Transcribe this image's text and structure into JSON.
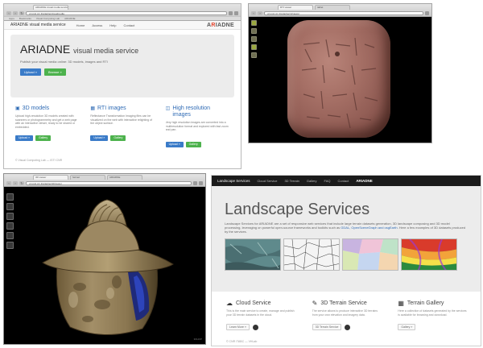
{
  "panel1": {
    "tab": "ARIADNE visual media service",
    "url": "vcg.isti.cnr.it/ariadne/visualmedia",
    "bookmarks": [
      "Apps",
      "Bookmarks",
      "Visual Computing Lab",
      "ARIADNE"
    ],
    "nav": {
      "brand": "ARIADNE visual media service",
      "items": [
        "Home",
        "Access",
        "Help",
        "Contact"
      ],
      "logo_pre": "A",
      "logo_r": "R",
      "logo_post": "IADNE"
    },
    "hero": {
      "title": "ARIADNE",
      "title_small": "visual media service",
      "lead": "Publish your visual media online: 3D models, images and RTI",
      "btn_primary": "Upload »",
      "btn_secondary": "Browse »"
    },
    "columns": [
      {
        "icon": "▣",
        "title": "3D models",
        "text": "Upload high-resolution 3D models created with scanners or photogrammetry and get a web page with an interactive viewer, ready to be shared or embedded.",
        "btn_primary": "Upload »",
        "btn_secondary": "Gallery"
      },
      {
        "icon": "▦",
        "title": "RTI images",
        "text": "Reflectance Transformation Imaging files can be visualized on the web with interactive relighting of the object surface.",
        "btn_primary": "Upload »",
        "btn_secondary": "Gallery"
      },
      {
        "icon": "◫",
        "title": "High resolution images",
        "text": "Very high resolution images are converted into a multiresolution format and explored with fast zoom and pan.",
        "btn_primary": "Upload »",
        "btn_secondary": "Gallery"
      }
    ],
    "footer": "© Visual Computing Lab — ISTI CNR"
  },
  "panel2": {
    "tabs": [
      "RTI viewer",
      "tablet"
    ],
    "url": "vcg.isti.cnr.it/ariadne/rti/viewer"
  },
  "panel3": {
    "tabs": [
      "3D viewer",
      "helmet",
      "ARIADNE"
    ],
    "url": "vcg.isti.cnr.it/ariadne/3d/viewer",
    "footer": "3DHOP"
  },
  "panel4": {
    "nav": {
      "brand": "Landscape Services",
      "items": [
        "Cloud Service",
        "3D Terrain",
        "Gallery",
        "FAQ",
        "Contact"
      ],
      "logo": "ARIADNE"
    },
    "title": "Landscape Services",
    "lead_start": "Landscape Services for ARIADNE are a set of responsive web services that include large terrain datasets generation, 3D landscape composing and 3D model processing, leveraging on powerful open-source frameworks and toolkits such as ",
    "lead_link": "GDAL, OpenSceneGraph and osgEarth",
    "lead_end": ". Here a few examples of 3D datasets produced by the services.",
    "columns": [
      {
        "icon": "☁",
        "title": "Cloud Service",
        "text": "This is the main service to create, manage and publish your 3D terrain datasets in the cloud.",
        "btn": "Learn More »"
      },
      {
        "icon": "✎",
        "title": "3D Terrain Service",
        "text": "The service allows to produce interactive 3D terrains from your own elevation and imagery data.",
        "btn": "3D Terrain Service"
      },
      {
        "icon": "▦",
        "title": "Terrain Gallery",
        "text": "Here a collection of datasets generated by the services is available for browsing and download.",
        "btn": "Gallery »"
      }
    ],
    "footer": "© CNR ITABC — VHLab"
  },
  "colors": {
    "ariadne_red": "#e2432b",
    "bootstrap_blue": "#3a7bc8",
    "bootstrap_green": "#4db24d",
    "link_blue": "#2f6bb5",
    "dark_nav": "#1b1b1b"
  }
}
